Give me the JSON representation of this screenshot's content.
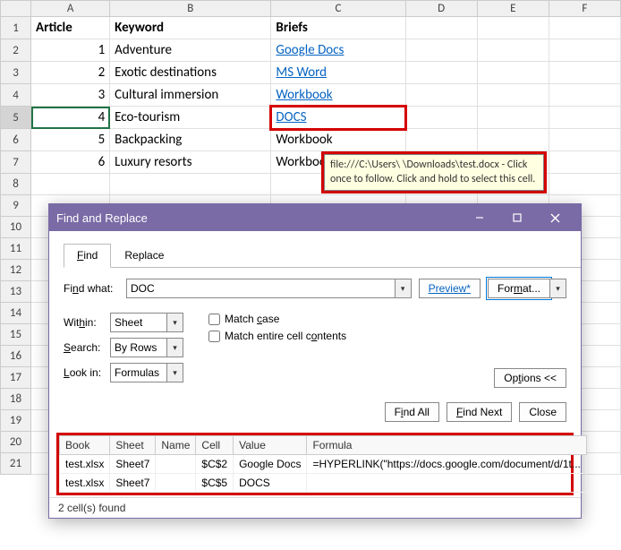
{
  "columns": [
    "A",
    "B",
    "C",
    "D",
    "E",
    "F"
  ],
  "rows": [
    "1",
    "2",
    "3",
    "4",
    "5",
    "6",
    "7",
    "8",
    "9",
    "10",
    "11",
    "12",
    "13",
    "14",
    "15",
    "16",
    "17",
    "18",
    "19",
    "20",
    "21"
  ],
  "headers": {
    "A": "Article",
    "B": "Keyword",
    "C": "Briefs"
  },
  "data": [
    {
      "num": "1",
      "keyword": "Adventure",
      "brief": "Google Docs",
      "link": true
    },
    {
      "num": "2",
      "keyword": "Exotic destinations",
      "brief": "MS Word",
      "link": true
    },
    {
      "num": "3",
      "keyword": "Cultural immersion",
      "brief": "Workbook",
      "link": true
    },
    {
      "num": "4",
      "keyword": "Eco-tourism",
      "brief": "DOCS",
      "link": true
    },
    {
      "num": "5",
      "keyword": "Backpacking",
      "brief": "Workbook"
    },
    {
      "num": "6",
      "keyword": "Luxury resorts",
      "brief": "Workbook"
    }
  ],
  "tooltip": "file:///C:\\Users\\       \\Downloads\\test.docx - Click once to follow. Click and hold to select this cell.",
  "dialog": {
    "title": "Find and Replace",
    "tabs": {
      "find": "Find",
      "replace": "Replace"
    },
    "find_what_label": "Find what:",
    "find_what_value": "DOC",
    "preview": "Preview*",
    "format": "Format...",
    "within_label": "Within:",
    "within_value": "Sheet",
    "search_label": "Search:",
    "search_value": "By Rows",
    "lookin_label": "Look in:",
    "lookin_value": "Formulas",
    "match_case": "Match case",
    "match_entire": "Match entire cell contents",
    "options": "Options <<",
    "find_all": "Find All",
    "find_next": "Find Next",
    "close": "Close",
    "results_headers": [
      "Book",
      "Sheet",
      "Name",
      "Cell",
      "Value",
      "Formula"
    ],
    "results_rows": [
      {
        "book": "test.xlsx",
        "sheet": "Sheet7",
        "name": "",
        "cell": "$C$2",
        "value": "Google Docs",
        "formula": "=HYPERLINK(\"https://docs.google.com/document/d/1t..."
      },
      {
        "book": "test.xlsx",
        "sheet": "Sheet7",
        "name": "",
        "cell": "$C$5",
        "value": "DOCS",
        "formula": ""
      }
    ],
    "status": "2 cell(s) found"
  }
}
